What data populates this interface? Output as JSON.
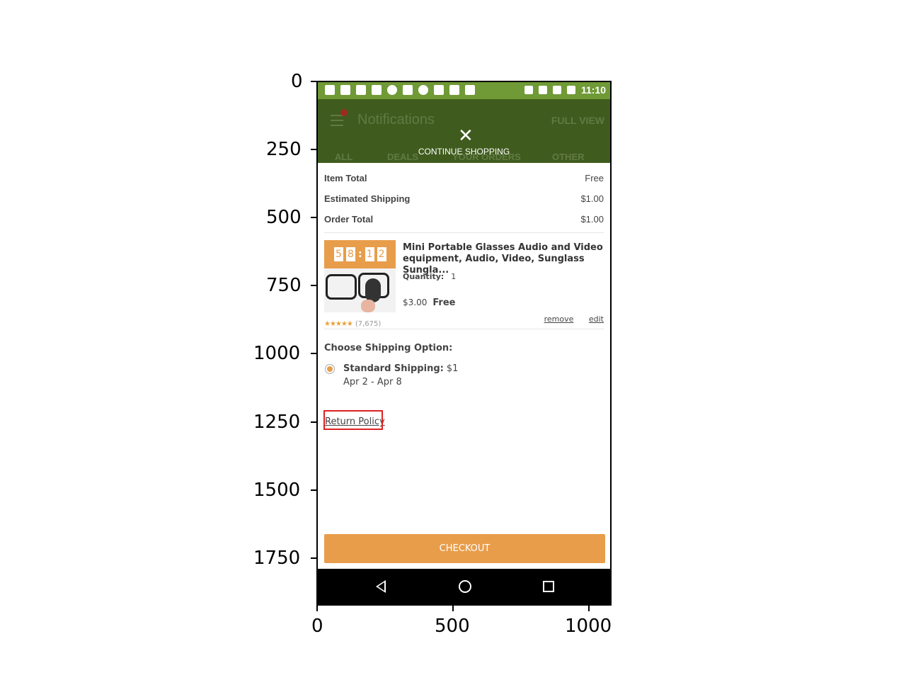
{
  "axes": {
    "yticks": [
      "0",
      "250",
      "500",
      "750",
      "1000",
      "1250",
      "1500",
      "1750"
    ],
    "xticks": [
      "0",
      "500",
      "1000"
    ]
  },
  "status_bar": {
    "time": "11:10"
  },
  "header": {
    "title": "Notifications",
    "full_view": "FULL VIEW",
    "tabs": [
      "ALL",
      "DEALS",
      "YOUR ORDERS",
      "OTHER"
    ],
    "continue_shopping": "CONTINUE SHOPPING",
    "close_glyph": "✕"
  },
  "summary": {
    "item_total_label": "Item Total",
    "item_total_value": "Free",
    "shipping_label": "Estimated Shipping",
    "shipping_value": "$1.00",
    "order_total_label": "Order Total",
    "order_total_value": "$1.00"
  },
  "product": {
    "timer_digits": [
      "5",
      "8",
      "1",
      "2"
    ],
    "title": "Mini Portable Glasses Audio and Video equipment, Audio, Video, Sunglass Sungla...",
    "quantity_label": "Quantity:",
    "quantity_value": "1",
    "price": "$3.00",
    "price_free": "Free",
    "remove": "remove",
    "edit": "edit",
    "stars": "★★★★★",
    "rating_count": "(7,675)"
  },
  "shipping": {
    "heading": "Choose Shipping Option:",
    "option_label": "Standard Shipping:",
    "option_price": "$1",
    "dates": "Apr 2 - Apr 8"
  },
  "return_policy": "Return Policy",
  "checkout_label": "CHECKOUT",
  "colors": {
    "accent": "#e89d4b",
    "status_bar": "#6f9a36",
    "overlay": "#3f5c1e",
    "highlight": "#dd2222"
  },
  "icons": {
    "back": "back-icon",
    "home": "home-icon",
    "recent": "recent-apps-icon",
    "menu": "menu-icon",
    "close": "close-icon"
  }
}
